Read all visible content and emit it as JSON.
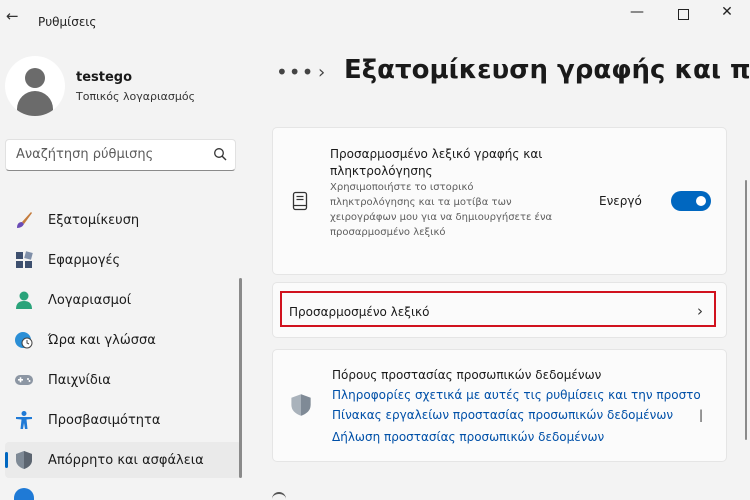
{
  "app": {
    "title": "Ρυθμίσεις"
  },
  "user": {
    "name": "testego",
    "account_type": "Τοπικός λογαριασμός"
  },
  "search": {
    "placeholder": "Αναζήτηση ρύθμισης"
  },
  "nav": {
    "items": [
      {
        "label": "Εξατομίκευση",
        "icon": "paintbrush-icon"
      },
      {
        "label": "Εφαρμογές",
        "icon": "apps-icon"
      },
      {
        "label": "Λογαριασμοί",
        "icon": "person-icon"
      },
      {
        "label": "Ώρα και γλώσσα",
        "icon": "clock-globe-icon"
      },
      {
        "label": "Παιχνίδια",
        "icon": "gamepad-icon"
      },
      {
        "label": "Προσβασιμότητα",
        "icon": "accessibility-icon"
      },
      {
        "label": "Απόρρητο και ασφάλεια",
        "icon": "shield-icon",
        "selected": true
      }
    ]
  },
  "breadcrumb": {
    "more": "•••",
    "title": "Εξατομίκευση γραφής και πλη"
  },
  "card_dictionary": {
    "title": "Προσαρμοσμένο λεξικό γραφής και πληκτρολόγησης",
    "description": "Χρησιμοποιήστε το ιστορικό πληκτρολόγησης και τα μοτίβα των χειρογράφων μου για να δημιουργήσετε ένα προσαρμοσμένο λεξικό",
    "state_label": "Ενεργό",
    "toggle_on": true
  },
  "card_custom_dictionary": {
    "label": "Προσαρμοσμένο λεξικό"
  },
  "card_privacy": {
    "title": "Πόρους προστασίας προσωπικών δεδομένων",
    "links": [
      "Πληροφορίες σχετικά με αυτές τις ρυθμίσεις και την προστο",
      "Πίνακας εργαλείων προστασίας προσωπικών δεδομένων",
      "Δήλωση προστασίας προσωπικών δεδομένων"
    ],
    "separator": "|"
  },
  "colors": {
    "accent": "#0067c0",
    "highlight": "#d1121e",
    "link": "#0050a8"
  }
}
